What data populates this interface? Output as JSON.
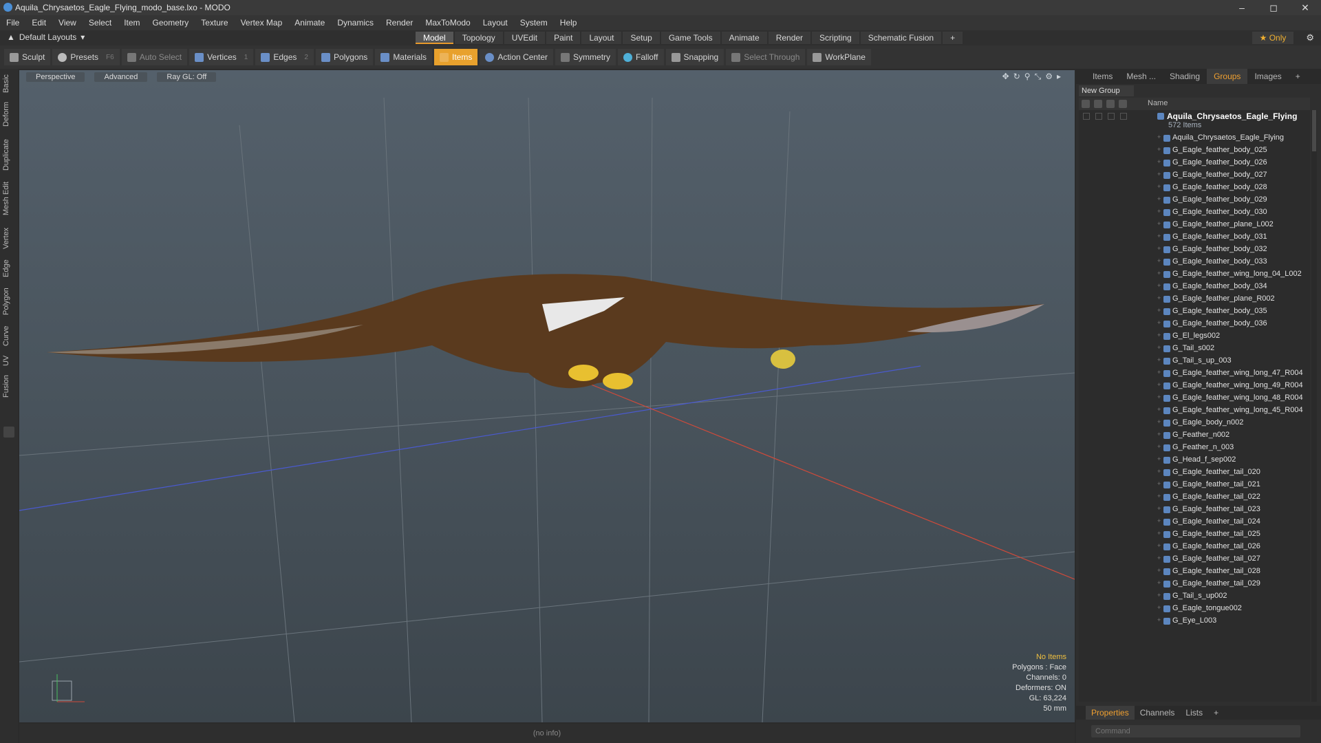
{
  "window": {
    "title": "Aquila_Chrysaetos_Eagle_Flying_modo_base.lxo - MODO"
  },
  "menu": [
    "File",
    "Edit",
    "View",
    "Select",
    "Item",
    "Geometry",
    "Texture",
    "Vertex Map",
    "Animate",
    "Dynamics",
    "Render",
    "MaxToModo",
    "Layout",
    "System",
    "Help"
  ],
  "layout_selector": "Default Layouts",
  "mode_tabs": [
    "Model",
    "Topology",
    "UVEdit",
    "Paint",
    "Layout",
    "Setup",
    "Game Tools",
    "Animate",
    "Render",
    "Scripting",
    "Schematic Fusion"
  ],
  "active_mode": "Model",
  "only_label": "Only",
  "toolbar": {
    "sculpt": "Sculpt",
    "presets": "Presets",
    "presets_key": "F6",
    "auto_select": "Auto Select",
    "vertices": "Vertices",
    "vertices_key": "1",
    "edges": "Edges",
    "edges_key": "2",
    "polygons": "Polygons",
    "materials": "Materials",
    "items": "Items",
    "action_center": "Action Center",
    "symmetry": "Symmetry",
    "falloff": "Falloff",
    "snapping": "Snapping",
    "select_through": "Select Through",
    "workplane": "WorkPlane"
  },
  "left_tabs": [
    "Basic",
    "Deform",
    "Duplicate",
    "Mesh Edit",
    "Vertex",
    "Edge",
    "Polygon",
    "Curve",
    "UV",
    "Fusion"
  ],
  "viewport": {
    "view": "Perspective",
    "shading": "Advanced",
    "raygl": "Ray GL: Off",
    "info": {
      "items": "No Items",
      "polygons": "Polygons : Face",
      "channels": "Channels: 0",
      "deformers": "Deformers: ON",
      "gl": "GL: 63,224",
      "focal": "50 mm"
    }
  },
  "status": "(no info)",
  "right_panel": {
    "tabs": [
      "Items",
      "Mesh ...",
      "Shading",
      "Groups",
      "Images"
    ],
    "active_tab": "Groups",
    "new_group": "New Group",
    "name_header": "Name",
    "root": {
      "label": "Aquila_Chrysaetos_Eagle_Flying",
      "count": "572 Items"
    },
    "items": [
      "Aquila_Chrysaetos_Eagle_Flying",
      "G_Eagle_feather_body_025",
      "G_Eagle_feather_body_026",
      "G_Eagle_feather_body_027",
      "G_Eagle_feather_body_028",
      "G_Eagle_feather_body_029",
      "G_Eagle_feather_body_030",
      "G_Eagle_feather_plane_L002",
      "G_Eagle_feather_body_031",
      "G_Eagle_feather_body_032",
      "G_Eagle_feather_body_033",
      "G_Eagle_feather_wing_long_04_L002",
      "G_Eagle_feather_body_034",
      "G_Eagle_feather_plane_R002",
      "G_Eagle_feather_body_035",
      "G_Eagle_feather_body_036",
      "G_El_legs002",
      "G_Tail_s002",
      "G_Tail_s_up_003",
      "G_Eagle_feather_wing_long_47_R004",
      "G_Eagle_feather_wing_long_49_R004",
      "G_Eagle_feather_wing_long_48_R004",
      "G_Eagle_feather_wing_long_45_R004",
      "G_Eagle_body_n002",
      "G_Feather_n002",
      "G_Feather_n_003",
      "G_Head_f_sep002",
      "G_Eagle_feather_tail_020",
      "G_Eagle_feather_tail_021",
      "G_Eagle_feather_tail_022",
      "G_Eagle_feather_tail_023",
      "G_Eagle_feather_tail_024",
      "G_Eagle_feather_tail_025",
      "G_Eagle_feather_tail_026",
      "G_Eagle_feather_tail_027",
      "G_Eagle_feather_tail_028",
      "G_Eagle_feather_tail_029",
      "G_Tail_s_up002",
      "G_Eagle_tongue002",
      "G_Eye_L003"
    ],
    "bottom_tabs": [
      "Properties",
      "Channels",
      "Lists"
    ],
    "active_bottom": "Properties",
    "command_placeholder": "Command"
  },
  "colors": {
    "accent": "#e8a12d",
    "x_axis": "#d04a3a",
    "z_axis": "#4a5ad0"
  }
}
